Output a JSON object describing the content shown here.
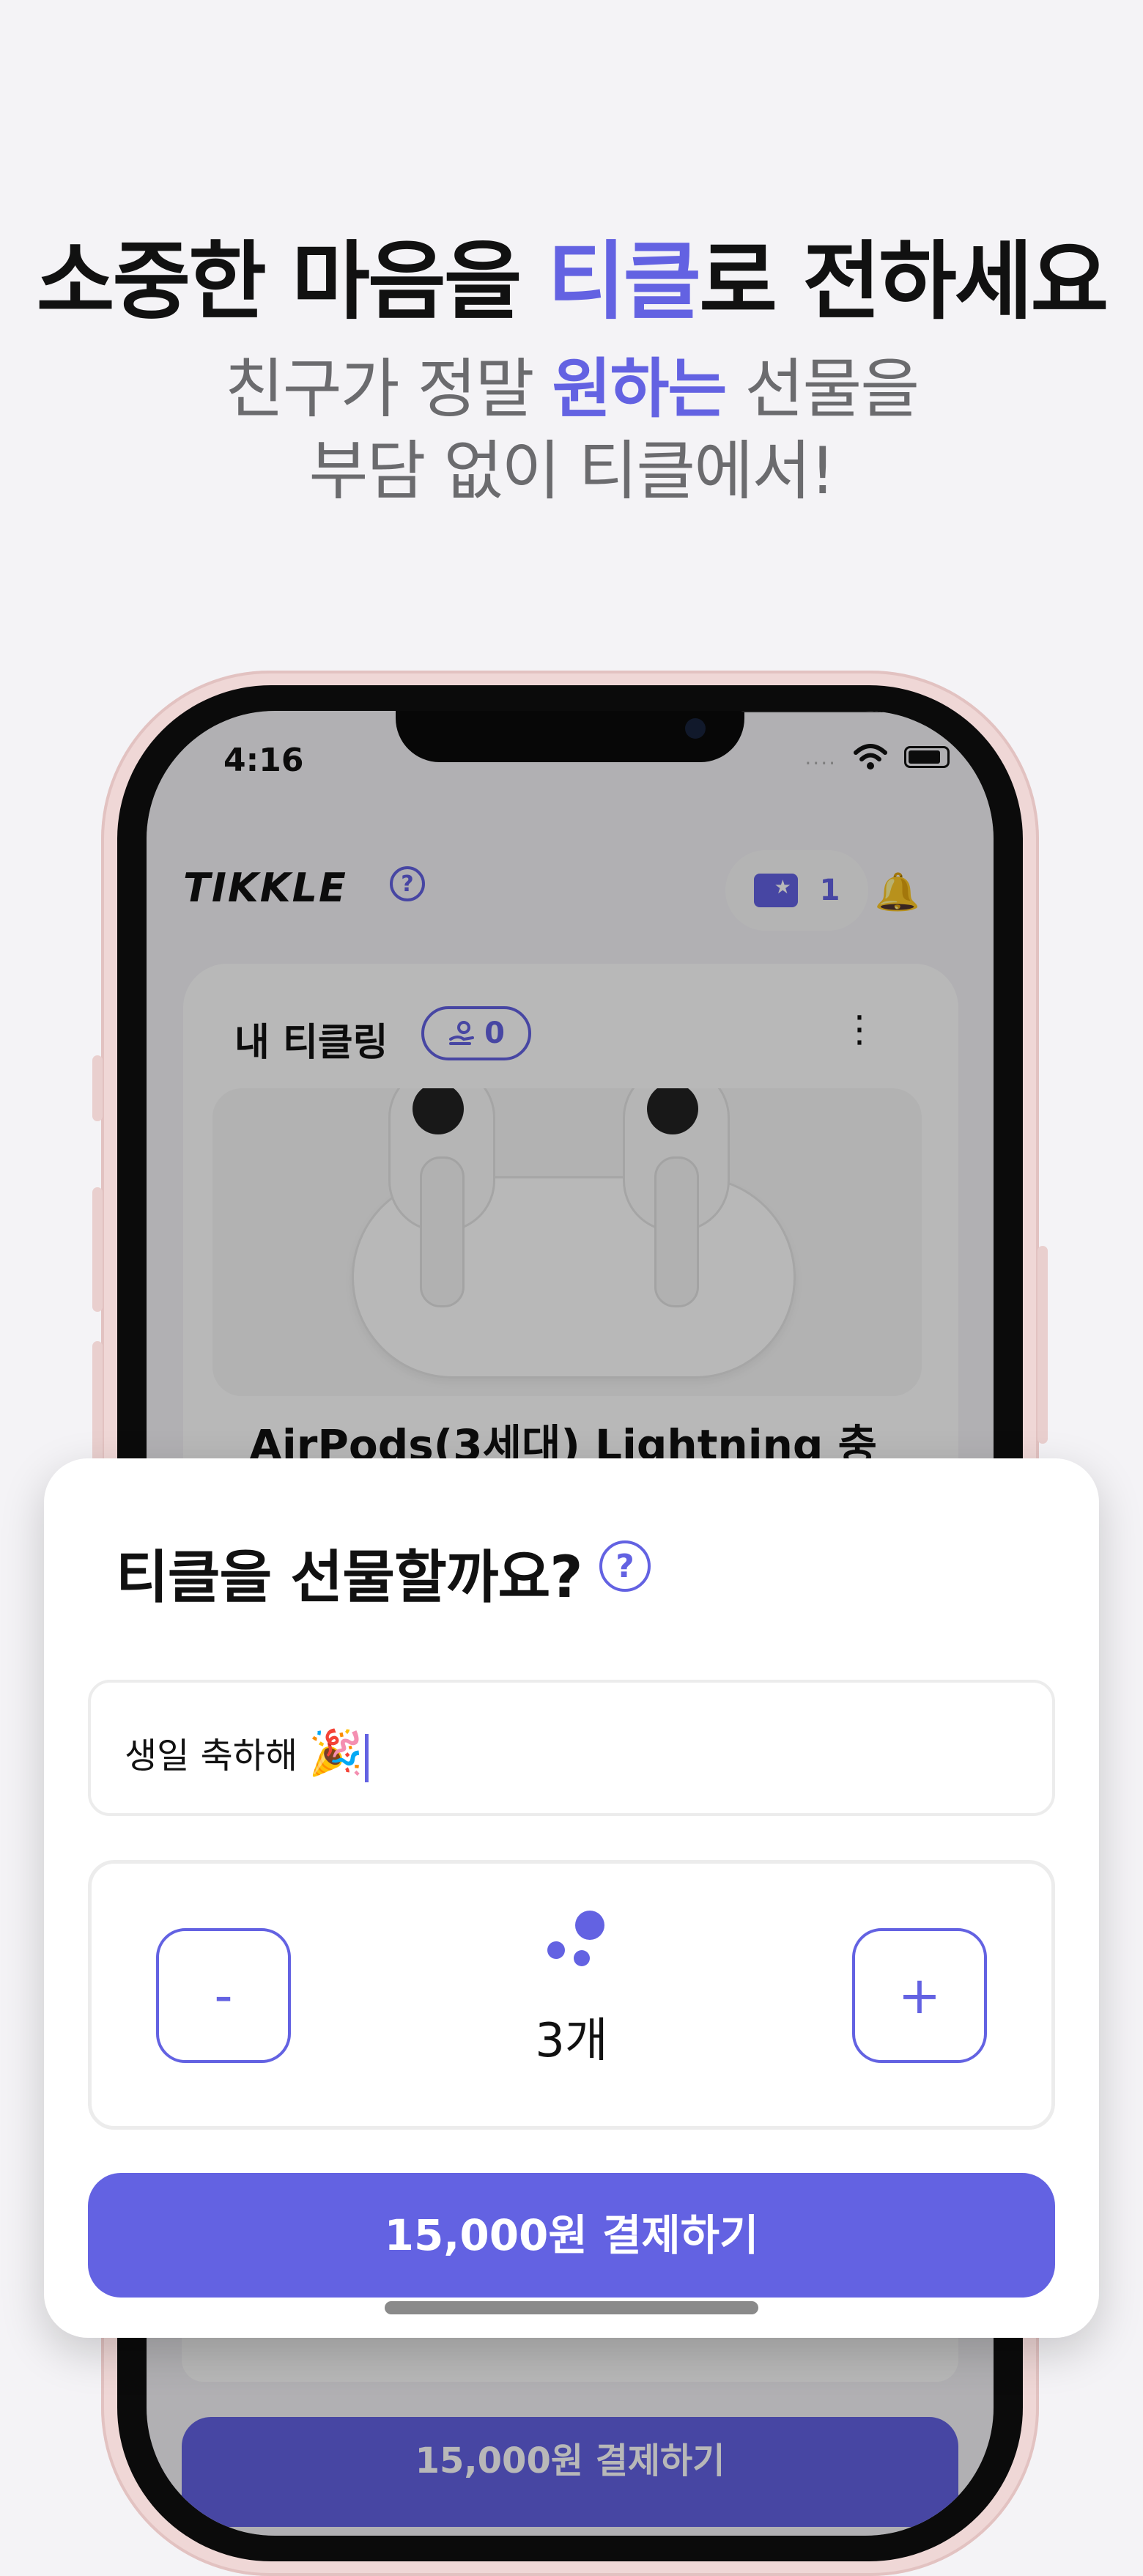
{
  "promo": {
    "headline_pre": "소중한 마음을 ",
    "headline_accent": "티클",
    "headline_post": "로 전하세요",
    "sub_line1_pre": "친구가 정말 ",
    "sub_line1_accent": "원하는",
    "sub_line1_post": " 선물을",
    "sub_line2": "부담 없이 티클에서!"
  },
  "status_bar": {
    "time": "4:16",
    "dots": "....",
    "wifi_icon": "wifi-icon",
    "battery_icon": "battery-icon"
  },
  "app_header": {
    "logo": "TIKKLE",
    "help": "?",
    "ticket_count": "1"
  },
  "my_tikkling": {
    "title": "내 티클링",
    "count": "0",
    "menu": "⋮",
    "product_name": "AirPods(3세대) Lightning 충"
  },
  "background_pay_label": "15,000원 결제하기",
  "sheet": {
    "title": "티클을 선물할까요?",
    "help": "?",
    "message_value": "생일 축하해",
    "message_emoji": "🎉",
    "minus_label": "-",
    "plus_label": "+",
    "quantity": 3,
    "quantity_label": "3개",
    "pay_label": "15,000원 결제하기"
  },
  "colors": {
    "accent": "#6362e2",
    "background": "#f4f3f6",
    "phone_frame": "#efd7d6"
  }
}
